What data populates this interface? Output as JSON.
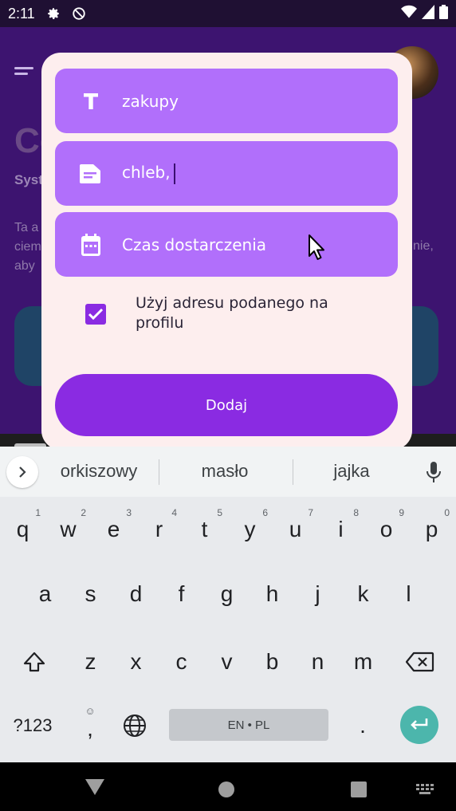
{
  "status_bar": {
    "time": "2:11",
    "icons": [
      "settings-icon",
      "do-not-disturb-icon",
      "wifi-icon",
      "signal-icon",
      "battery-icon"
    ]
  },
  "background_app": {
    "title_partial": "Co",
    "subtitle_partial": "Syst",
    "text_partial_lines": [
      "Ta a",
      "ciem",
      "aby"
    ],
    "text_right_partial": "nie,"
  },
  "dialog": {
    "title_field": {
      "value": "zakupy",
      "icon": "text-icon"
    },
    "content_field": {
      "value": "chleb,",
      "icon": "notes-icon"
    },
    "delivery_field": {
      "placeholder": "Czas dostarczenia",
      "icon": "calendar-icon"
    },
    "use_profile_address": {
      "label": "Użyj adresu podanego na profilu",
      "checked": true
    },
    "add_button": {
      "label": "Dodaj"
    }
  },
  "keyboard": {
    "suggestions": [
      "orkiszowy",
      "masło",
      "jajka"
    ],
    "row1": [
      {
        "key": "q",
        "num": "1"
      },
      {
        "key": "w",
        "num": "2"
      },
      {
        "key": "e",
        "num": "3"
      },
      {
        "key": "r",
        "num": "4"
      },
      {
        "key": "t",
        "num": "5"
      },
      {
        "key": "y",
        "num": "6"
      },
      {
        "key": "u",
        "num": "7"
      },
      {
        "key": "i",
        "num": "8"
      },
      {
        "key": "o",
        "num": "9"
      },
      {
        "key": "p",
        "num": "0"
      }
    ],
    "row2": [
      "a",
      "s",
      "d",
      "f",
      "g",
      "h",
      "j",
      "k",
      "l"
    ],
    "row3": [
      "z",
      "x",
      "c",
      "v",
      "b",
      "n",
      "m"
    ],
    "symbols_key": "?123",
    "comma_key": ",",
    "period_key": ".",
    "spacebar_label": "EN • PL",
    "accent_color": "#4cb6ac"
  },
  "colors": {
    "field_bg": "#b16ffb",
    "primary": "#8a2be2",
    "dialog_bg": "#fdeeee"
  }
}
